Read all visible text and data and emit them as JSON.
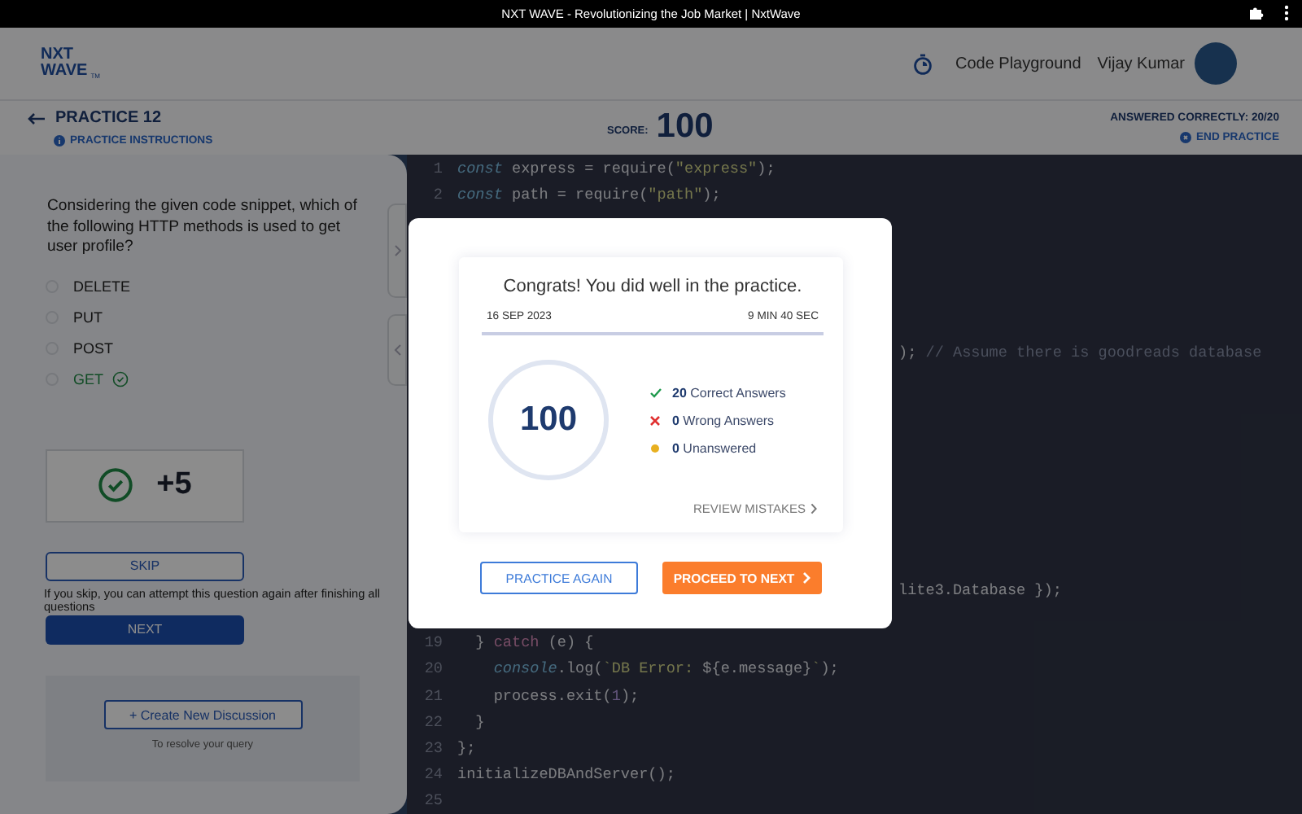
{
  "browser_bar": {
    "title": "NXT WAVE - Revolutionizing the Job Market | NxtWave"
  },
  "header": {
    "logo_lines": [
      "NXT",
      "WAVE"
    ],
    "logo_mark": "TM",
    "nav_link": "Code Playground",
    "user_name": "Vijay Kumar"
  },
  "practice_bar": {
    "title": "PRACTICE 12",
    "instructions": "PRACTICE INSTRUCTIONS",
    "score_label": "SCORE:",
    "score": "100",
    "answered": "ANSWERED CORRECTLY: 20/20",
    "end": "END PRACTICE"
  },
  "question": {
    "text": "Considering the given code snippet, which of the following HTTP methods is used to get user profile?",
    "options": [
      {
        "label": "DELETE",
        "selected": false,
        "correct": false
      },
      {
        "label": "PUT",
        "selected": false,
        "correct": false
      },
      {
        "label": "POST",
        "selected": false,
        "correct": false
      },
      {
        "label": "GET",
        "selected": false,
        "correct": true
      }
    ],
    "points": "+5",
    "skip": "SKIP",
    "skip_note": "If you skip, you can attempt this question again after finishing all questions",
    "next": "NEXT",
    "discussion_button": "+ Create New Discussion",
    "discussion_hint": "To resolve your query"
  },
  "editor": {
    "top_lines": [
      {
        "number": "1",
        "tokens": [
          {
            "kind": "keyword",
            "text": "const"
          },
          {
            "kind": "plain",
            "text": " express = require("
          },
          {
            "kind": "string",
            "text": "\"express\""
          },
          {
            "kind": "plain",
            "text": ");"
          }
        ]
      },
      {
        "number": "2",
        "tokens": [
          {
            "kind": "keyword",
            "text": "const"
          },
          {
            "kind": "plain",
            "text": " path = require("
          },
          {
            "kind": "string",
            "text": "\"path\""
          },
          {
            "kind": "plain",
            "text": ");"
          }
        ]
      }
    ],
    "covered_lines": [
      {
        "tokens": [
          {
            "kind": "plain",
            "text": "); "
          },
          {
            "kind": "comment",
            "text": "// Assume there is goodreads database"
          }
        ]
      },
      {
        "tokens": [
          {
            "kind": "plain",
            "text": "lite3.Database });"
          }
        ]
      }
    ],
    "bottom_lines": [
      {
        "number": "19",
        "tokens": [
          {
            "kind": "plain",
            "text": "  } "
          },
          {
            "kind": "control",
            "text": "catch"
          },
          {
            "kind": "plain",
            "text": " (e) {"
          }
        ]
      },
      {
        "number": "20",
        "tokens": [
          {
            "kind": "keyword",
            "text": "    console"
          },
          {
            "kind": "plain",
            "text": ".log("
          },
          {
            "kind": "string",
            "text": "`DB Error: "
          },
          {
            "kind": "plain",
            "text": "${e.message}"
          },
          {
            "kind": "string",
            "text": "`"
          },
          {
            "kind": "plain",
            "text": ");"
          }
        ]
      },
      {
        "number": "21",
        "tokens": [
          {
            "kind": "plain",
            "text": "    process.exit("
          },
          {
            "kind": "number",
            "text": "1"
          },
          {
            "kind": "plain",
            "text": ");"
          }
        ]
      },
      {
        "number": "22",
        "tokens": [
          {
            "kind": "plain",
            "text": "  }"
          }
        ]
      },
      {
        "number": "23",
        "tokens": [
          {
            "kind": "plain",
            "text": "};"
          }
        ]
      },
      {
        "number": "24",
        "tokens": [
          {
            "kind": "plain",
            "text": "initializeDBAndServer();"
          }
        ]
      },
      {
        "number": "25"
      }
    ]
  },
  "result_modal": {
    "title": "Congrats! You did well in the practice.",
    "date": "16 SEP 2023",
    "duration": "9 MIN 40 SEC",
    "score": "100",
    "stats": [
      {
        "kind": "correct",
        "count": "20",
        "label": "Correct Answers"
      },
      {
        "kind": "wrong",
        "count": "0",
        "label": "Wrong Answers"
      },
      {
        "kind": "unanswered",
        "count": "0",
        "label": "Unanswered"
      }
    ],
    "review": "REVIEW MISTAKES",
    "practice_again": "PRACTICE AGAIN",
    "proceed": "PROCEED TO NEXT"
  }
}
